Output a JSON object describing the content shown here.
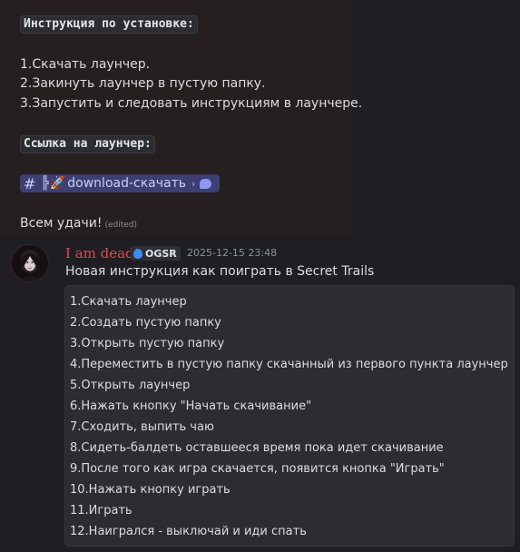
{
  "previous_message": {
    "install_heading": "Инструкция по установке:",
    "steps": [
      "1.Скачать лаунчер.",
      "2.Закинуть лаунчер в пустую папку.",
      "3.Запустить и следовать инструкциям в лаунчере."
    ],
    "link_heading": "Ссылка на лаунчер:",
    "channel_link": {
      "hash": "#",
      "separator": "╠",
      "emoji": "🚀",
      "label": "download-скачать",
      "chevron": "›"
    },
    "farewell": "Всем удачи!",
    "edited_label": "(edited)"
  },
  "message": {
    "username": "I am dead",
    "tag": "OGSR",
    "timestamp": "2025-12-15 23:48",
    "headline": "Новая инструкция как поиграть в Secret Trails",
    "code_lines": [
      "1.Скачать лаунчер",
      "2.Создать пустую папку",
      "3.Открыть пустую папку",
      "4.Переместить в пустую папку скачанный из первого пункта лаунчер",
      "5.Открыть лаунчер",
      "6.Нажать кнопку \"Начать скачивание\"",
      "7.Сходить, выпить чаю",
      "8.Сидеть-балдеть оставшееся время пока идет скачивание",
      "9.После того как игра скачается, появится кнопка \"Играть\"",
      "10.Нажать кнопку играть",
      "11.Играть",
      "12.Наигрался - выключай и иди спать"
    ]
  },
  "colors": {
    "username": "#e0495b",
    "channel_chip_bg": "#3d3f72",
    "code_bg": "#2b2d31"
  },
  "icons": {
    "tag_icon": "flame-icon",
    "channel_bubble": "speech-bubble-icon"
  }
}
